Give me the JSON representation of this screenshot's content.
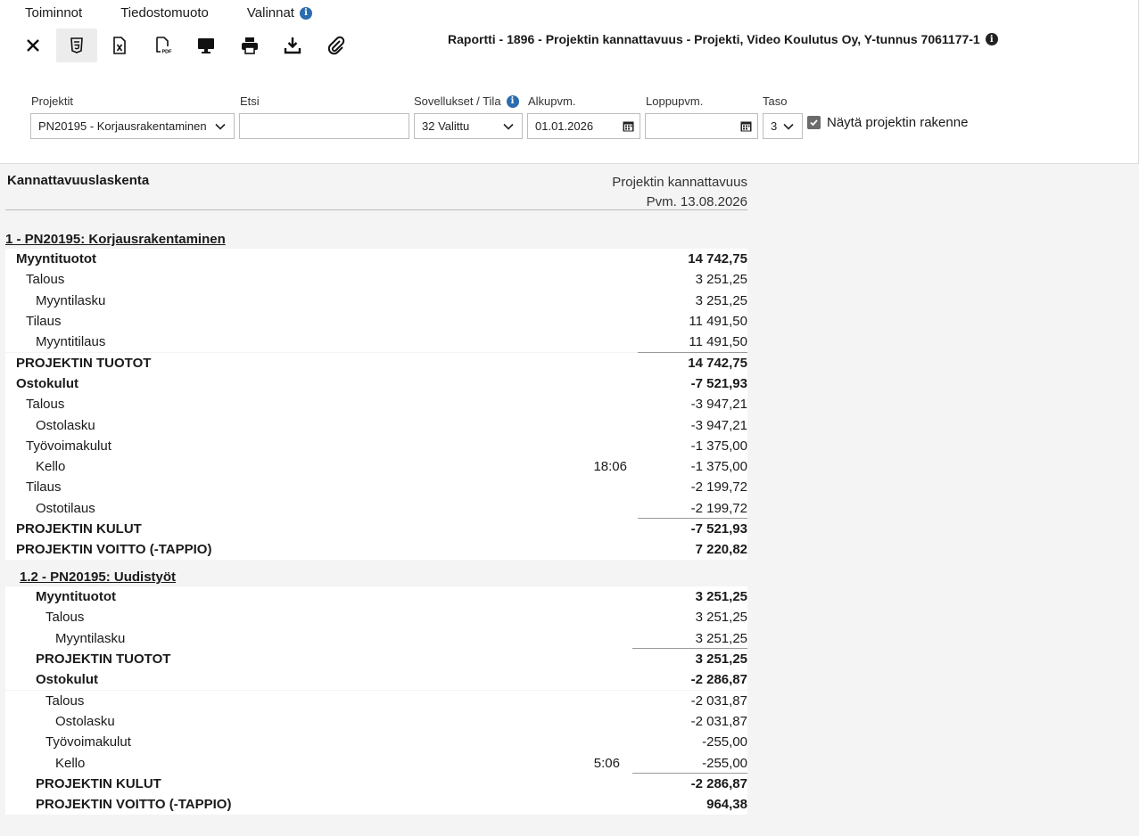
{
  "menu": {
    "toiminnot": "Toiminnot",
    "tiedostomuoto": "Tiedostomuoto",
    "valinnat": "Valinnat"
  },
  "toolbar": [
    "close-icon",
    "html5-icon",
    "excel-icon",
    "pdf-icon",
    "monitor-icon",
    "printer-icon",
    "download-icon",
    "paperclip-icon"
  ],
  "report_title": "Raportti - 1896 - Projektin kannattavuus - Projekti, Video Koulutus Oy, Y-tunnus 7061177-1",
  "filters": {
    "projektit_label": "Projektit",
    "projektit_value": "PN20195 - Korjausrakentaminen",
    "etsi_label": "Etsi",
    "etsi_value": "",
    "sovellukset_label": "Sovellukset / Tila",
    "sovellukset_value": "32 Valittu",
    "alkupvm_label": "Alkupvm.",
    "alkupvm_value": "01.01.2026",
    "loppupvm_label": "Loppupvm.",
    "loppupvm_value": "",
    "taso_label": "Taso",
    "taso_value": "3",
    "show_structure_label": "Näytä projektin rakenne",
    "show_structure_checked": true
  },
  "report": {
    "heading": "Kannattavuuslaskenta",
    "type": "Projektin kannattavuus",
    "date": "Pvm. 13.08.2026",
    "sections": [
      {
        "title": "1 - PN20195: Korjausrakentaminen",
        "rows": [
          {
            "label": "Myyntituotot",
            "amount": "14 742,75",
            "bold": true,
            "level": 0
          },
          {
            "label": "Talous",
            "amount": "3 251,25",
            "level": 1
          },
          {
            "label": "Myyntilasku",
            "amount": "3 251,25",
            "level": 2
          },
          {
            "label": "Tilaus",
            "amount": "11 491,50",
            "level": 1
          },
          {
            "label": "Myyntitilaus",
            "amount": "11 491,50",
            "level": 2
          },
          {
            "label": "PROJEKTIN TUOTOT",
            "amount": "14 742,75",
            "bold": true,
            "level": 0,
            "sumline": true
          },
          {
            "label": "Ostokulut",
            "amount": "-7 521,93",
            "bold": true,
            "level": 0
          },
          {
            "label": "Talous",
            "amount": "-3 947,21",
            "level": 1
          },
          {
            "label": "Ostolasku",
            "amount": "-3 947,21",
            "level": 2
          },
          {
            "label": "Työvoimakulut",
            "amount": "-1 375,00",
            "level": 1
          },
          {
            "label": "Kello",
            "time": "18:06",
            "amount": "-1 375,00",
            "level": 2
          },
          {
            "label": "Tilaus",
            "amount": "-2 199,72",
            "level": 1
          },
          {
            "label": "Ostotilaus",
            "amount": "-2 199,72",
            "level": 2
          },
          {
            "label": "PROJEKTIN KULUT",
            "amount": "-7 521,93",
            "bold": true,
            "level": 0,
            "sumline": true
          },
          {
            "label": "PROJEKTIN VOITTO (-TAPPIO)",
            "amount": "7 220,82",
            "bold": true,
            "level": 0
          }
        ]
      },
      {
        "title": "1.2 - PN20195: Uudistyöt",
        "rows": [
          {
            "label": "Myyntituotot",
            "amount": "3 251,25",
            "bold": true,
            "level": 0
          },
          {
            "label": "Talous",
            "amount": "3 251,25",
            "level": 1
          },
          {
            "label": "Myyntilasku",
            "amount": "3 251,25",
            "level": 2
          },
          {
            "label": "PROJEKTIN TUOTOT",
            "amount": "3 251,25",
            "bold": true,
            "level": 0,
            "sumline": true
          },
          {
            "label": "Ostokulut",
            "amount": "-2 286,87",
            "bold": true,
            "level": 0
          },
          {
            "label": "Talous",
            "amount": "-2 031,87",
            "level": 1
          },
          {
            "label": "Ostolasku",
            "amount": "-2 031,87",
            "level": 2
          },
          {
            "label": "Työvoimakulut",
            "amount": "-255,00",
            "level": 1
          },
          {
            "label": "Kello",
            "time": "5:06",
            "amount": "-255,00",
            "level": 2
          },
          {
            "label": "PROJEKTIN KULUT",
            "amount": "-2 286,87",
            "bold": true,
            "level": 0,
            "sumline": true
          },
          {
            "label": "PROJEKTIN VOITTO (-TAPPIO)",
            "amount": "964,38",
            "bold": true,
            "level": 0
          }
        ]
      }
    ]
  }
}
